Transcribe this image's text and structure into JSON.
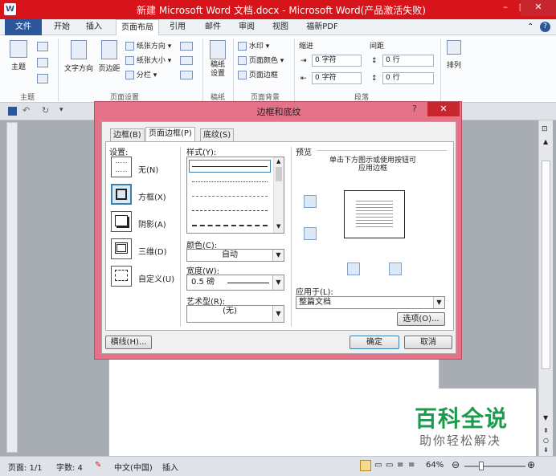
{
  "window": {
    "title": "新建 Microsoft Word 文档.docx - Microsoft Word(产品激活失败)",
    "app_icon": "W",
    "minimize": "–",
    "maximize": "□",
    "close": "✕"
  },
  "ribbon_tabs": [
    "文件",
    "开始",
    "插入",
    "页面布局",
    "引用",
    "邮件",
    "审阅",
    "视图",
    "福新PDF"
  ],
  "ribbon": {
    "theme_group": {
      "label": "主题",
      "theme_btn": "主题"
    },
    "page_setup": {
      "label": "页面设置",
      "text_dir": "文字方向",
      "margins": "页边距",
      "orientation": "纸张方向",
      "size": "纸张大小",
      "columns": "分栏"
    },
    "manuscript": {
      "label": "稿纸",
      "btn": "稿纸\n设置"
    },
    "page_bg": {
      "label": "页面背景",
      "watermark": "水印",
      "page_color": "页面颜色",
      "page_borders": "页面边框"
    },
    "paragraph": {
      "label": "段落",
      "indent": "缩进",
      "spacing": "间距",
      "indent_left": "0 字符",
      "indent_right": "0 字符",
      "space_before": "0 行",
      "space_after": "0 行"
    },
    "arrange": {
      "label": "排列"
    }
  },
  "dialog": {
    "title": "边框和底纹",
    "help": "?",
    "close": "✕",
    "tabs": [
      "边框(B)",
      "页面边框(P)",
      "底纹(S)"
    ],
    "setting_label": "设置:",
    "settings": [
      "无(N)",
      "方框(X)",
      "阴影(A)",
      "三维(D)",
      "自定义(U)"
    ],
    "style_label": "样式(Y):",
    "color_label": "颜色(C):",
    "color_value": "自动",
    "width_label": "宽度(W):",
    "width_value": "0.5 磅",
    "art_label": "艺术型(R):",
    "art_value": "(无)",
    "preview_label": "预览",
    "preview_hint": "单击下方图示或使用按钮可\n应用边框",
    "apply_label": "应用于(L):",
    "apply_value": "整篇文档",
    "options_btn": "选项(O)...",
    "hline_btn": "横线(H)...",
    "ok_btn": "确定",
    "cancel_btn": "取消"
  },
  "status": {
    "page": "页面: 1/1",
    "words": "字数: 4",
    "lang": "中文(中国)",
    "mode": "插入",
    "zoom": "64%"
  },
  "watermark": {
    "line1": "百科全说",
    "line2": "助你轻松解决"
  }
}
